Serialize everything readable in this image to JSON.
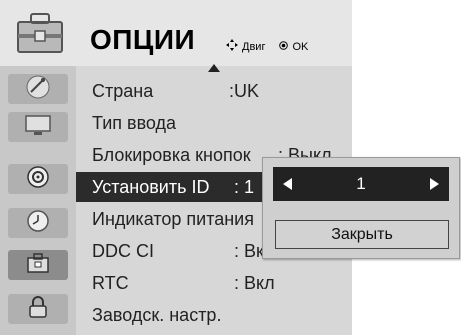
{
  "header": {
    "title": "ОПЦИИ",
    "move_hint": "Двиг",
    "ok_hint": "OK"
  },
  "sidebar": {
    "items": [
      {
        "icon": "satellite-dish-icon",
        "active": false
      },
      {
        "icon": "monitor-icon",
        "active": false
      },
      {
        "icon": "speaker-icon",
        "active": false
      },
      {
        "icon": "clock-icon",
        "active": false
      },
      {
        "icon": "options-toolbox-icon",
        "active": true
      },
      {
        "icon": "lock-icon",
        "active": false
      }
    ]
  },
  "menu": {
    "items": [
      {
        "label": "Страна",
        "value": ":UK"
      },
      {
        "label": "Тип ввода",
        "value": ""
      },
      {
        "label": "Блокировка кнопок",
        "value": ": Выкл"
      },
      {
        "label": "Установить ID",
        "value": ": 1"
      },
      {
        "label": "Индикатор питания",
        "value": ""
      },
      {
        "label": "DDC CI",
        "value": ": Вкл"
      },
      {
        "label": "RTC",
        "value": ": Вкл"
      },
      {
        "label": "Заводск. настр.",
        "value": ""
      }
    ],
    "selected_index": 3
  },
  "popup": {
    "value": "1",
    "close_label": "Закрыть"
  },
  "colors": {
    "selected_bg": "#2b2b2b",
    "panel_bg": "#d7d7d7"
  }
}
